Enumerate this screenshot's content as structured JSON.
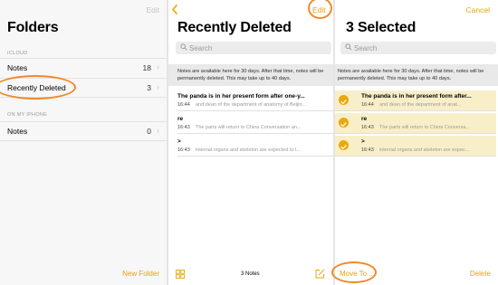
{
  "folders_panel": {
    "edit_label": "Edit",
    "title": "Folders",
    "section_icloud": "ICLOUD",
    "section_iphone": "ON MY IPHONE",
    "icloud_folders": [
      {
        "label": "Notes",
        "count": "18"
      },
      {
        "label": "Recently Deleted",
        "count": "3"
      }
    ],
    "iphone_folders": [
      {
        "label": "Notes",
        "count": "0"
      }
    ],
    "new_folder_label": "New Folder"
  },
  "deleted_panel": {
    "edit_label": "Edit",
    "title": "Recently Deleted",
    "search_placeholder": "Search",
    "notice": "Notes are available here for 30 days. After that time, notes will be permanently deleted. This may take up to 40 days.",
    "notes": [
      {
        "title": "The panda is in her present form after one-y...",
        "time": "16:44",
        "preview": "and dean of the department of anatomy of Beijin..."
      },
      {
        "title": "re",
        "time": "16:43",
        "preview": "The parts will return to China Conversation an..."
      },
      {
        "title": ">",
        "time": "16:43",
        "preview": "internal organs and skeleton are expected to l..."
      }
    ],
    "count_label": "3 Notes"
  },
  "selected_panel": {
    "title": "3 Selected",
    "cancel_label": "Cancel",
    "search_placeholder": "Search",
    "notice": "Notes are available here for 30 days. After that time, notes will be permanently deleted. This may take up to 40 days.",
    "notes": [
      {
        "title": "The panda is in her present form after...",
        "time": "16:44",
        "preview": "and dean of the department of anat..."
      },
      {
        "title": "re",
        "time": "16:43",
        "preview": "The parts will return to China Conversa..."
      },
      {
        "title": ">",
        "time": "16:43",
        "preview": "internal organs and skeleton are expec..."
      }
    ],
    "move_to_label": "Move To...",
    "delete_label": "Delete"
  },
  "colors": {
    "accent": "#e8a30c",
    "callout": "#ef8a2a",
    "selected_row": "#f8efc9"
  }
}
